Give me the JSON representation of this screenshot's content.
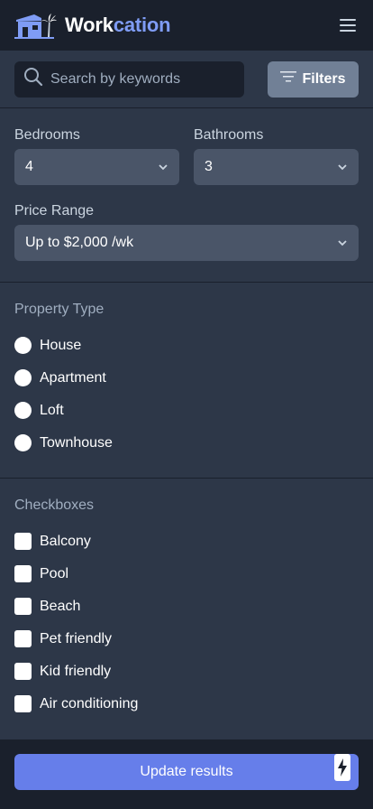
{
  "app": {
    "brand_part1": "Work",
    "brand_part2": "cation",
    "logo_icon": "beach-house-icon",
    "menu_icon": "hamburger-menu-icon"
  },
  "search": {
    "placeholder": "Search by keywords",
    "value": "",
    "icon": "search-icon",
    "filters_label": "Filters",
    "filters_icon": "filter-lines-icon"
  },
  "filters": {
    "bedrooms_label": "Bedrooms",
    "bedrooms_value": "4",
    "bathrooms_label": "Bathrooms",
    "bathrooms_value": "3",
    "price_label": "Price Range",
    "price_value": "Up to $2,000 /wk"
  },
  "property_type": {
    "title": "Property Type",
    "options": [
      "House",
      "Apartment",
      "Loft",
      "Townhouse"
    ]
  },
  "checkboxes": {
    "title": "Checkboxes",
    "options": [
      "Balcony",
      "Pool",
      "Beach",
      "Pet friendly",
      "Kid friendly",
      "Air conditioning"
    ]
  },
  "footer": {
    "update_label": "Update results",
    "bolt_icon": "lightning-bolt-icon"
  },
  "colors": {
    "header_bg": "#1a202c",
    "body_bg": "#2d3748",
    "accent": "#7f9cf5",
    "button": "#667eea",
    "select_bg": "#4a5568"
  }
}
